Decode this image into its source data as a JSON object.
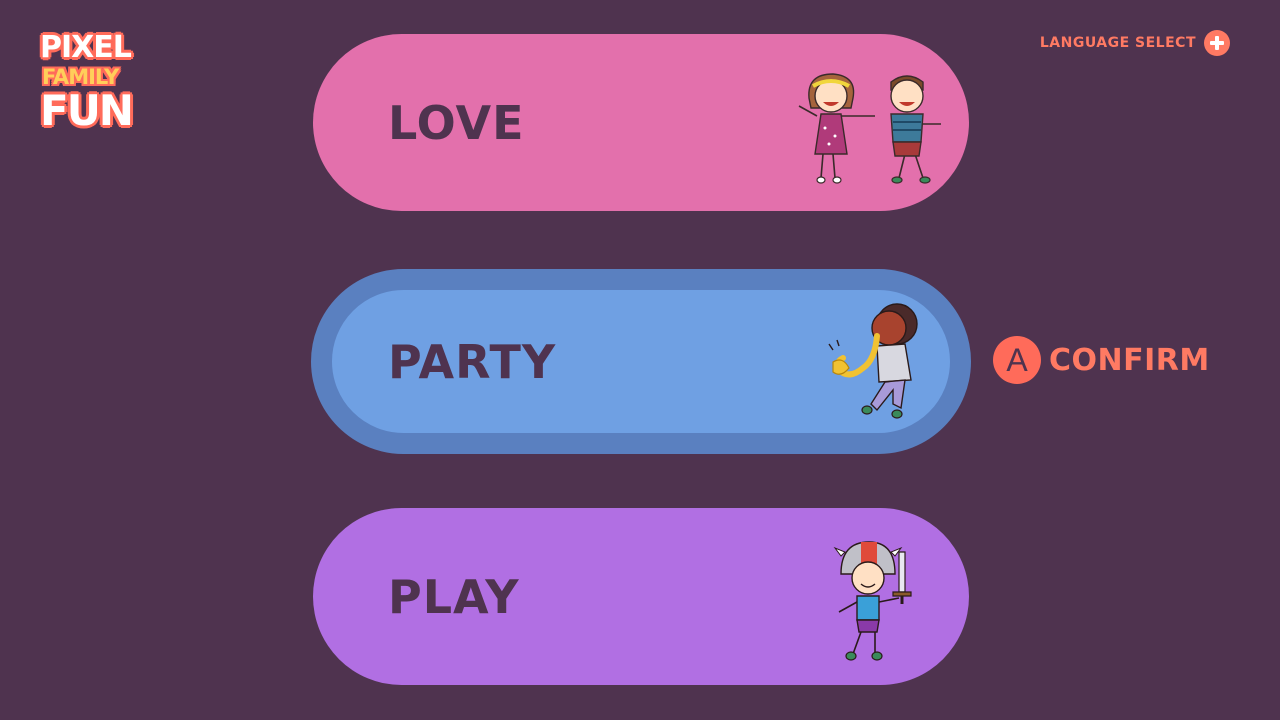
{
  "logo": {
    "line1": "PIXEL",
    "line2": "FAMILY",
    "line3": "FUN"
  },
  "header": {
    "language_select_label": "LANGUAGE SELECT",
    "language_select_icon": "plus-icon"
  },
  "menu": {
    "items": [
      {
        "label": "LOVE",
        "color": "#e370ac",
        "art": "two-kids-holding-hands-illustration",
        "selected": false
      },
      {
        "label": "PARTY",
        "color": "#6fa0e3",
        "border_color": "#5a80c0",
        "art": "kid-playing-saxophone-illustration",
        "selected": true
      },
      {
        "label": "PLAY",
        "color": "#b16fe3",
        "art": "kid-knight-with-sword-illustration",
        "selected": false
      }
    ]
  },
  "prompt": {
    "button_glyph": "A",
    "label": "CONFIRM"
  },
  "colors": {
    "background": "#4f334f",
    "accent": "#ff7a63",
    "logo_yellow": "#ffcf5a"
  }
}
